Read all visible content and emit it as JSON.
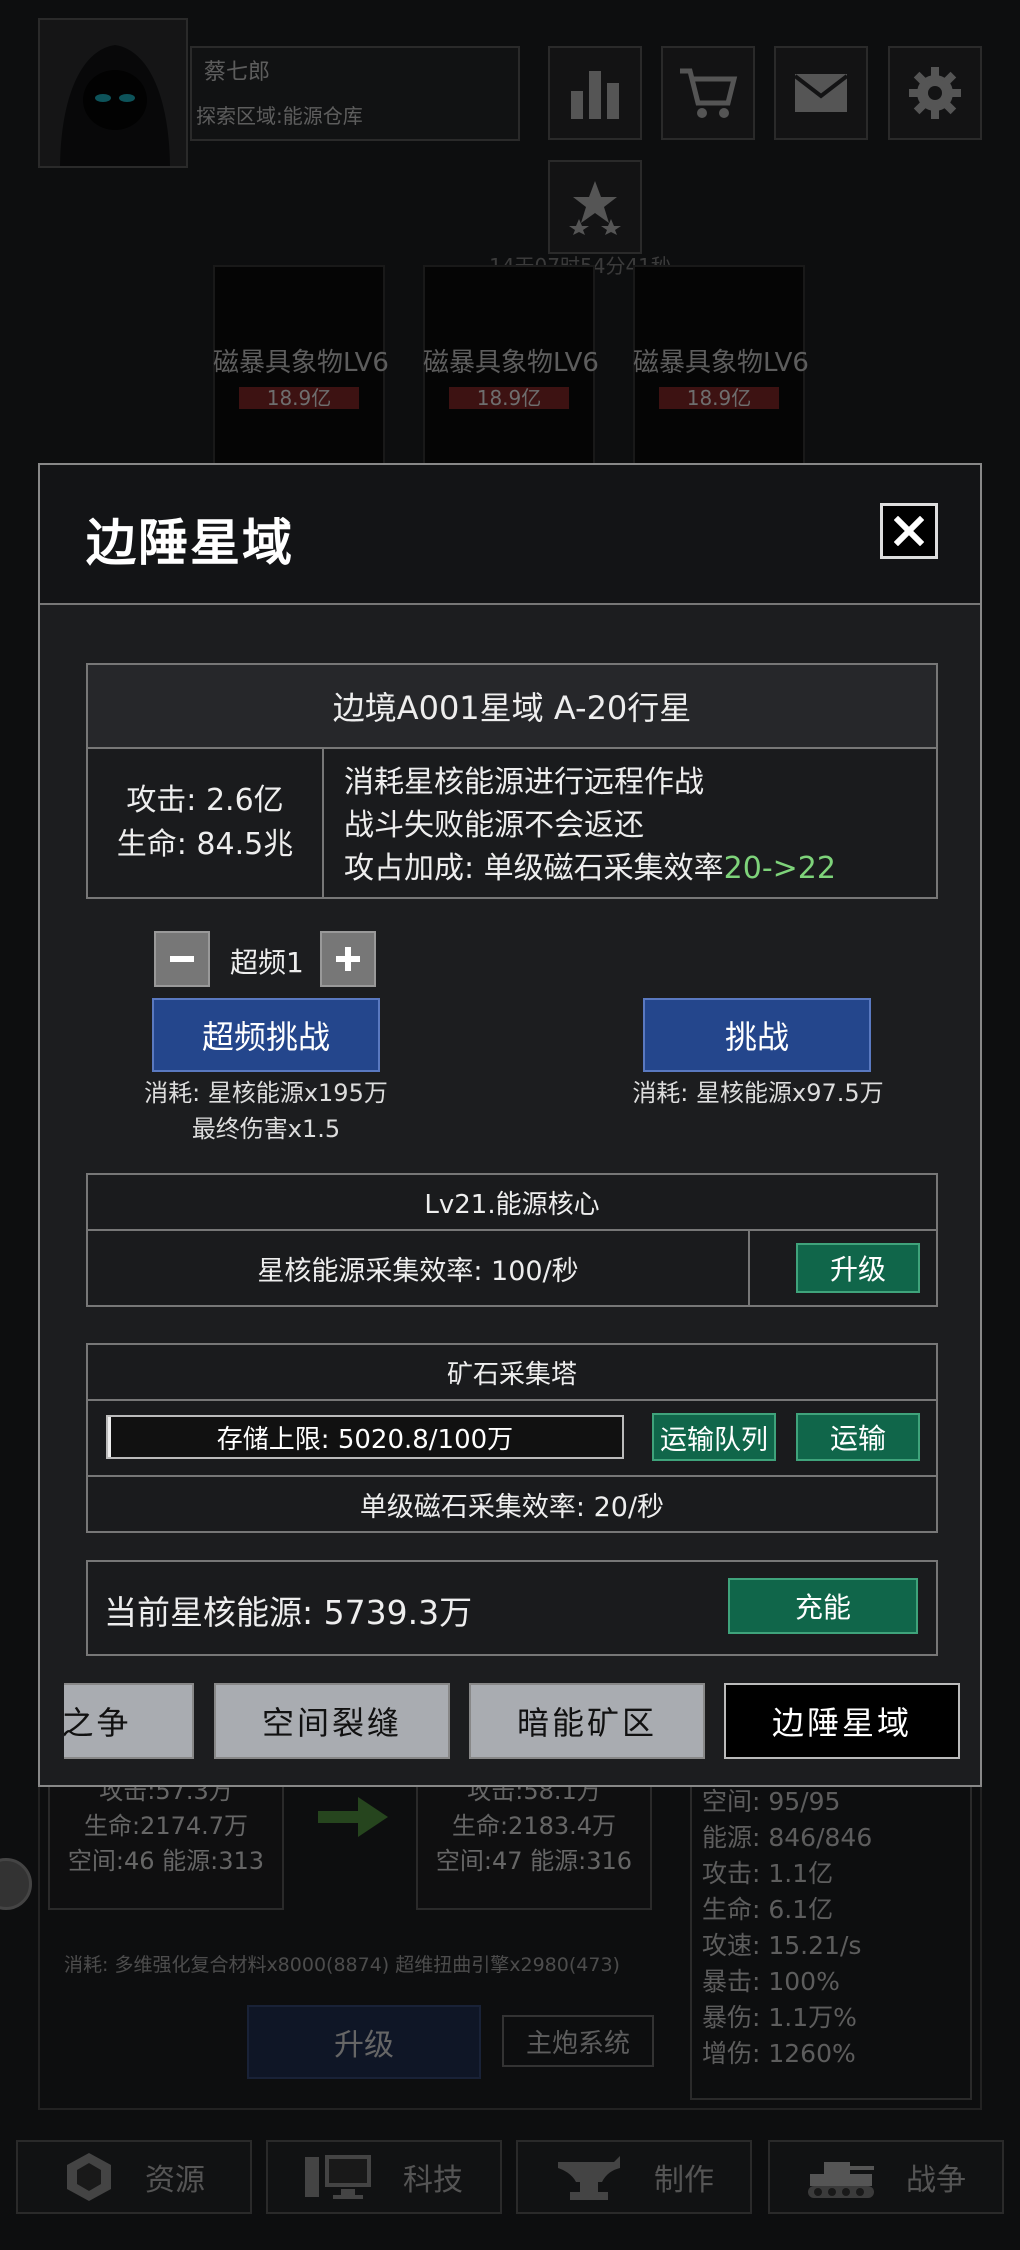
{
  "background": {
    "profile": {
      "name": "蔡七郎",
      "area": "探索区域:能源仓库"
    },
    "top_icons": [
      "stats-icon",
      "cart-icon",
      "mail-icon",
      "gear-icon"
    ],
    "event_timer": "14天07时54分41秒",
    "cards": [
      {
        "title": "磁暴具象物LV6",
        "value": "18.9亿"
      },
      {
        "title": "磁暴具象物LV6",
        "value": "18.9亿"
      },
      {
        "title": "磁暴具象物LV6",
        "value": "18.9亿"
      }
    ],
    "current_stats": {
      "attack": "攻击:57.3万",
      "life": "生命:2174.7万",
      "space_energy": "空间:46 能源:313"
    },
    "next_stats": {
      "attack": "攻击:58.1万",
      "life": "生命:2183.4万",
      "space_energy": "空间:47 能源:316"
    },
    "ship_stats": [
      "空间: 95/95",
      "能源: 846/846",
      "攻击: 1.1亿",
      "生命: 6.1亿",
      "攻速: 15.21/s",
      "暴击: 100%",
      "暴伤: 1.1万%",
      "增伤: 1260%"
    ],
    "upgrade_cost": "消耗: 多维强化复合材料x8000(8874) 超维扭曲引擎x2980(473)",
    "upgrade_label": "升级",
    "main_gun_label": "主炮系统",
    "nav": {
      "resources": "资源",
      "tech": "科技",
      "craft": "制作",
      "war": "战争"
    }
  },
  "modal": {
    "title": "边陲星域",
    "planet": {
      "name": "边境A001星域 A-20行星",
      "attack": "攻击: 2.6亿",
      "life": "生命: 84.5兆",
      "desc_line1": "消耗星核能源进行远程作战",
      "desc_line2": "战斗失败能源不会返还",
      "desc_line3_prefix": "攻占加成: 单级磁石采集效率",
      "desc_line3_value": "20->22"
    },
    "overclock": {
      "level_label": "超频1",
      "challenge_label": "超频挑战",
      "cost": "消耗: 星核能源x195万",
      "final_damage": "最终伤害x1.5"
    },
    "challenge": {
      "label": "挑战",
      "cost": "消耗: 星核能源x97.5万"
    },
    "core": {
      "title": "Lv21.能源核心",
      "rate": "星核能源采集效率: 100/秒",
      "upgrade_label": "升级"
    },
    "tower": {
      "title": "矿石采集塔",
      "storage": "存储上限: 5020.8/100万",
      "storage_fraction": 0.005,
      "queue_label": "运输队列",
      "transport_label": "运输",
      "rate": "单级磁石采集效率: 20/秒"
    },
    "energy": {
      "current": "当前星核能源: 5739.3万",
      "charge_label": "充能"
    },
    "tabs": [
      "雪之争",
      "空间裂缝",
      "暗能矿区",
      "边陲星域"
    ],
    "active_tab": "边陲星域"
  }
}
